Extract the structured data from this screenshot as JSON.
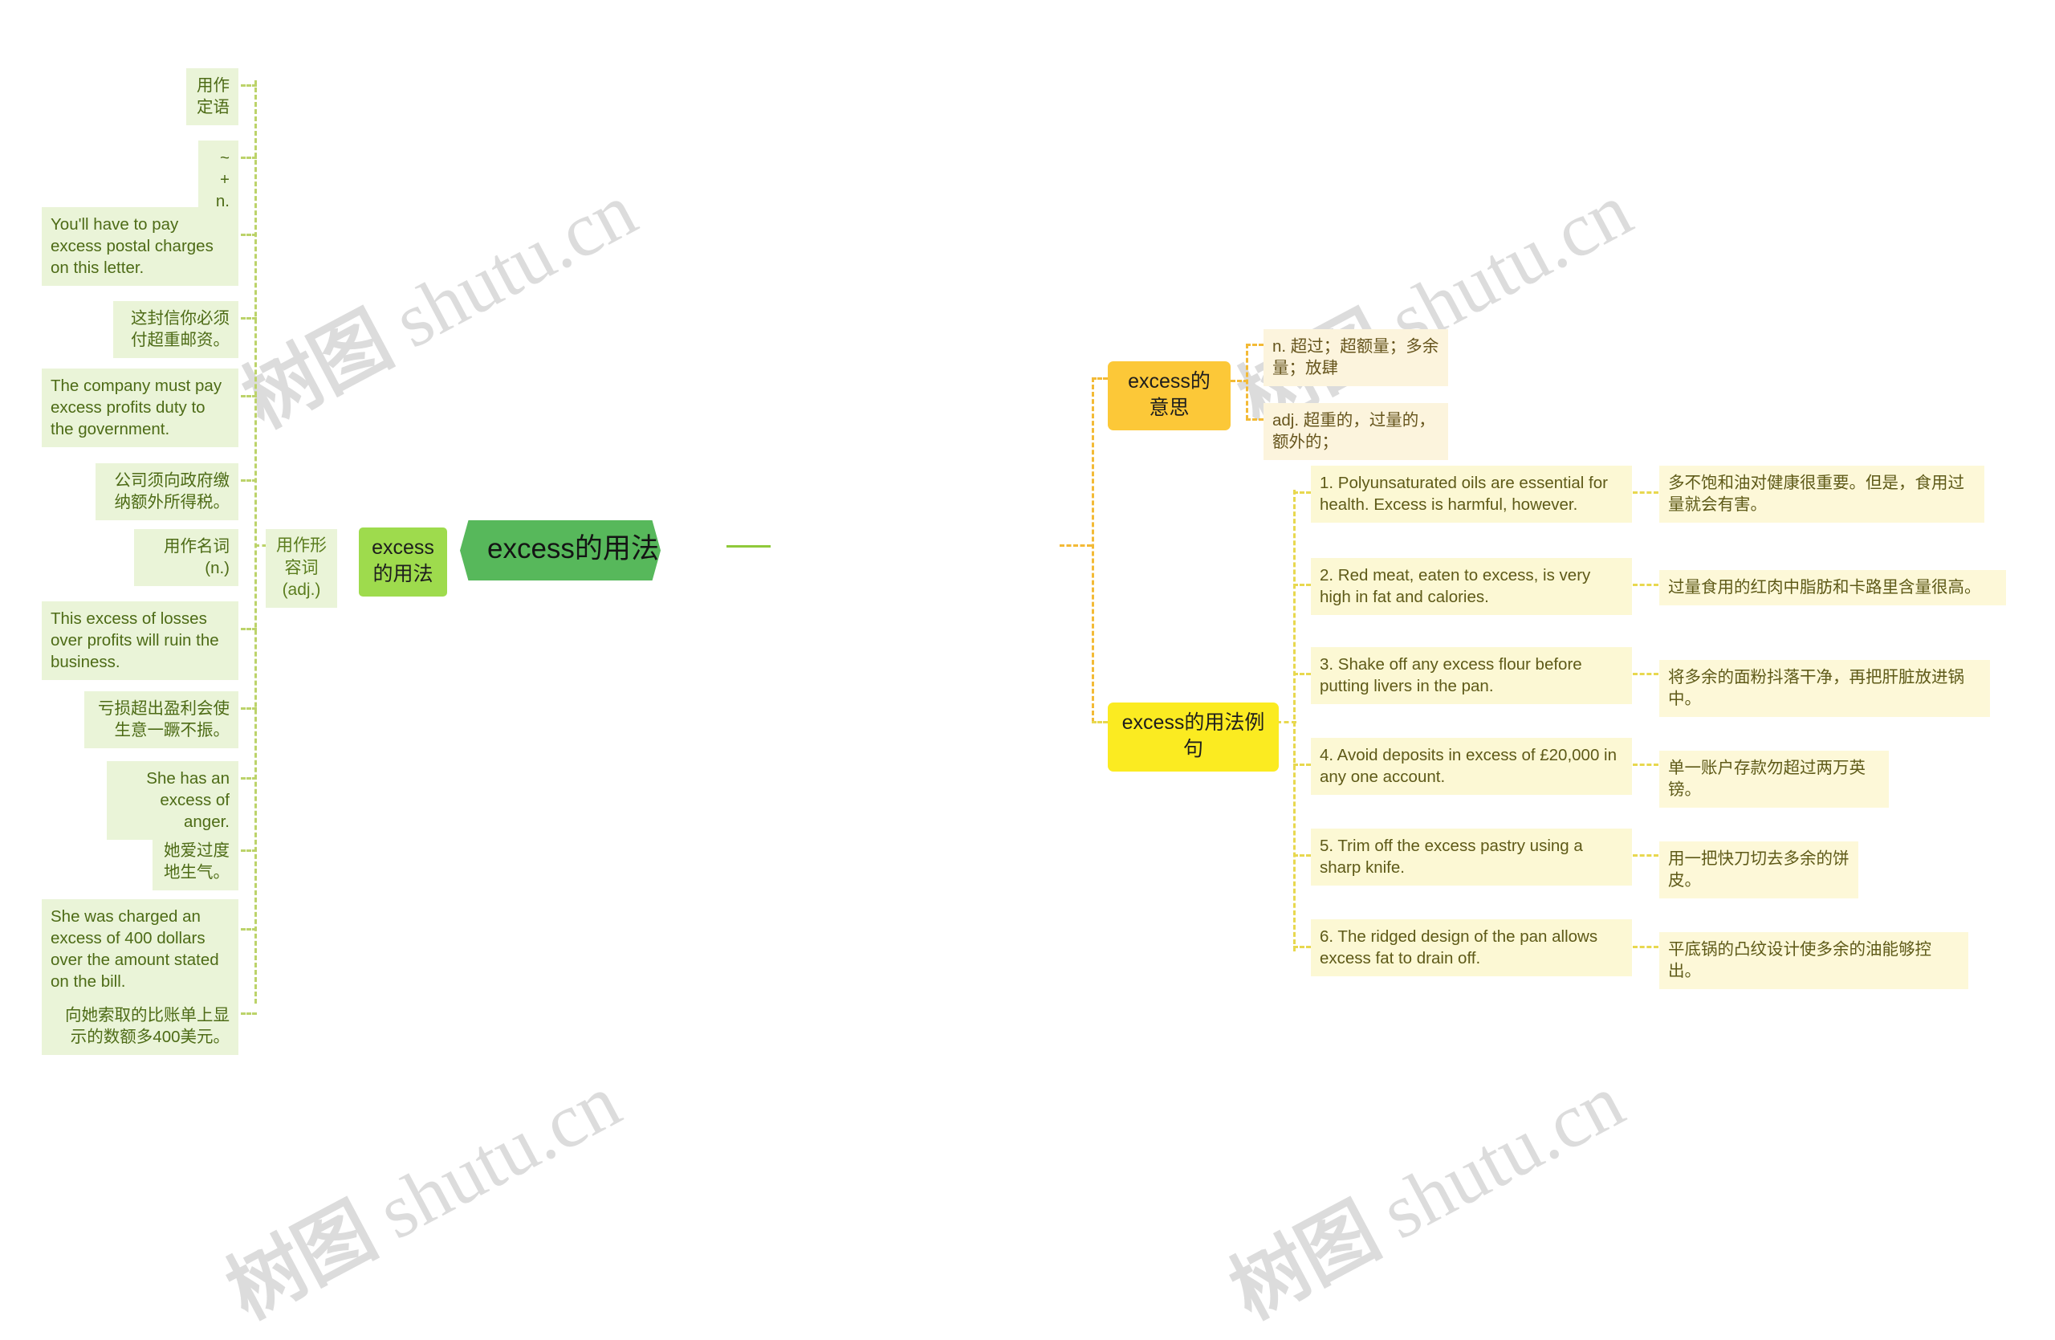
{
  "title": "excess的用法总结大全",
  "watermark": "树图 shutu.cn",
  "central": {
    "label": "excess的用法总结大全"
  },
  "left_branch": {
    "label": "excess的用法",
    "groups": [
      {
        "label": "用作形容词(adj.)",
        "items": [
          {
            "label": "用作定语"
          },
          {
            "label": "~ + n."
          },
          {
            "label": "You'll have to pay excess postal charges on this letter."
          },
          {
            "label": "这封信你必须付超重邮资。"
          },
          {
            "label": "The company must pay excess profits duty to the government."
          },
          {
            "label": "公司须向政府缴纳额外所得税。"
          }
        ]
      },
      {
        "label": "用作名词(n.)",
        "items": [
          {
            "label": "This excess of losses over profits will ruin the business."
          },
          {
            "label": "亏损超出盈利会使生意一蹶不振。"
          },
          {
            "label": "She has an excess of anger."
          },
          {
            "label": "她爱过度地生气。"
          },
          {
            "label": "She was charged an excess of 400 dollars over the amount stated on the bill."
          },
          {
            "label": "向她索取的比账单上显示的数额多400美元。"
          }
        ]
      }
    ]
  },
  "right_branches": [
    {
      "label": "excess的意思",
      "color": "#fcc838",
      "items": [
        {
          "label": "n. 超过；超额量；多余量；放肆"
        },
        {
          "label": "adj. 超重的，过量的，额外的；"
        }
      ]
    },
    {
      "label": "excess的用法例句",
      "color": "#fbeb21",
      "items": [
        {
          "en": "1. Polyunsaturated oils are essential for health. Excess is harmful, however.",
          "zh": "多不饱和油对健康很重要。但是，食用过量就会有害。"
        },
        {
          "en": "2. Red meat, eaten to excess, is very high in fat and calories.",
          "zh": "过量食用的红肉中脂肪和卡路里含量很高。"
        },
        {
          "en": "3. Shake off any excess flour before putting livers in the pan.",
          "zh": "将多余的面粉抖落干净，再把肝脏放进锅中。"
        },
        {
          "en": "4. Avoid deposits in excess of £20,000 in any one account.",
          "zh": "单一账户存款勿超过两万英镑。"
        },
        {
          "en": "5. Trim off the excess pastry using a sharp knife.",
          "zh": "用一把快刀切去多余的饼皮。"
        },
        {
          "en": "6. The ridged design of the pan allows excess fat to drain off.",
          "zh": "平底锅的凸纹设计使多余的油能够控出。"
        }
      ]
    }
  ],
  "colors": {
    "central_bg": "#57b85b",
    "branch_green_bg": "#9edb4d",
    "branch_amber_bg": "#fcc838",
    "branch_yellow_bg": "#fbeb21",
    "leaf_green_bg": "#eaf4d8",
    "leaf_amber_bg": "#fcf4dd",
    "leaf_yellow_bg": "#fcf8d4",
    "line_green": "#bcd36a",
    "line_amber": "#f3ba36"
  }
}
